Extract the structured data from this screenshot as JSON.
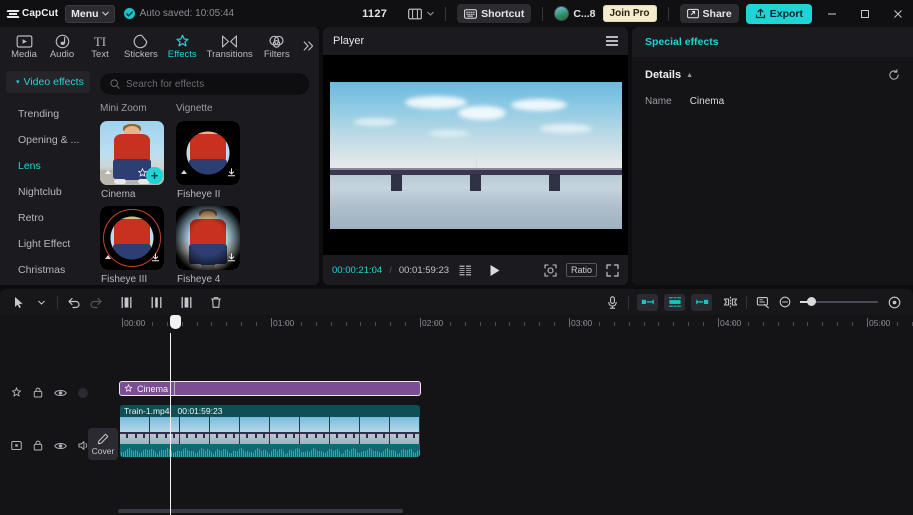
{
  "titlebar": {
    "app_name": "CapCut",
    "menu_label": "Menu",
    "autosave_text": "Auto saved: 10:05:44",
    "project_id": "1127",
    "shortcut_label": "Shortcut",
    "user_name": "C...8",
    "join_pro_label": "Join Pro",
    "share_label": "Share",
    "export_label": "Export",
    "minimize": "—",
    "maximize": "▫",
    "close": "✕",
    "accent": "#1fd4d4"
  },
  "left_panel": {
    "tabs": [
      {
        "label": "Media",
        "icon": "media-icon",
        "active": false
      },
      {
        "label": "Audio",
        "icon": "audio-icon",
        "active": false
      },
      {
        "label": "Text",
        "icon": "text-icon",
        "active": false
      },
      {
        "label": "Stickers",
        "icon": "stickers-icon",
        "active": false
      },
      {
        "label": "Effects",
        "icon": "effects-icon",
        "active": true
      },
      {
        "label": "Transitions",
        "icon": "transitions-icon",
        "active": false
      },
      {
        "label": "Filters",
        "icon": "filters-icon",
        "active": false
      }
    ],
    "more_tabs_icon": "chevron-double-right-icon",
    "category_header": "Video effects",
    "categories": [
      {
        "label": "Trending",
        "active": false
      },
      {
        "label": "Opening & ...",
        "active": false
      },
      {
        "label": "Lens",
        "active": true
      },
      {
        "label": "Nightclub",
        "active": false
      },
      {
        "label": "Retro",
        "active": false
      },
      {
        "label": "Light Effect",
        "active": false
      },
      {
        "label": "Christmas",
        "active": false
      }
    ],
    "search_placeholder": "Search for effects",
    "search_value": "",
    "grid_top_labels": [
      "Mini Zoom",
      "Vignette"
    ],
    "effects": [
      {
        "label": "Cinema",
        "style": "plain",
        "selected": true
      },
      {
        "label": "Fisheye II",
        "style": "circle"
      },
      {
        "label": "Fisheye III",
        "style": "circle-ring"
      },
      {
        "label": "Fisheye 4",
        "style": "vignette"
      }
    ]
  },
  "player": {
    "title": "Player",
    "menu_icon": "hamburger-icon",
    "current_time": "00:00:21:04",
    "separator": "/",
    "total_time": "00:01:59:23",
    "frames_icon": "frames-icon",
    "play_icon": "play-icon",
    "focus_icon": "focus-icon",
    "ratio_label": "Ratio",
    "fullscreen_icon": "fullscreen-icon"
  },
  "right_panel": {
    "title": "Special effects",
    "section_label": "Details",
    "reset_icon": "reset-icon",
    "rows": [
      {
        "key": "Name",
        "value": "Cinema"
      }
    ]
  },
  "timeline": {
    "tools_left": [
      {
        "name": "select-tool",
        "icon": "cursor-icon",
        "dim": false
      },
      {
        "name": "select-dropdown",
        "icon": "chevron-down-icon",
        "dim": false
      },
      {
        "name": "undo",
        "icon": "undo-icon",
        "dim": false
      },
      {
        "name": "redo",
        "icon": "redo-icon",
        "dim": true
      },
      {
        "name": "split",
        "icon": "split-icon",
        "dim": false
      },
      {
        "name": "trim-left",
        "icon": "trim-left-icon",
        "dim": false
      },
      {
        "name": "trim-right",
        "icon": "trim-right-icon",
        "dim": false
      },
      {
        "name": "delete",
        "icon": "trash-icon",
        "dim": false
      }
    ],
    "tools_right": [
      {
        "name": "record",
        "icon": "microphone-icon"
      },
      {
        "name": "keyframe-left",
        "icon": "keyframe-left-icon"
      },
      {
        "name": "keyframe-center",
        "icon": "keyframe-center-icon"
      },
      {
        "name": "keyframe-right",
        "icon": "keyframe-right-icon"
      },
      {
        "name": "mirror",
        "icon": "mirror-icon"
      },
      {
        "name": "crop",
        "icon": "crop-icon"
      },
      {
        "name": "zoom-out",
        "icon": "zoom-out-icon"
      },
      {
        "name": "zoom-in",
        "icon": "zoom-in-icon"
      }
    ],
    "ruler_labels": [
      "00:00",
      "01:00",
      "02:00",
      "03:00",
      "04:00",
      "05:00"
    ],
    "playhead_time": "00:00:21:04",
    "effect_track": {
      "icon": "effect-icon",
      "clip_label": "Cinema",
      "color": "#7a4d94"
    },
    "video_track": {
      "clip_name": "Train-1.mp4",
      "clip_duration": "00:01:59:23",
      "cover_label": "Cover",
      "cover_icon": "pencil-icon"
    },
    "track_controls_effect": [
      {
        "name": "effect-track-icon",
        "icon": "effect-icon"
      },
      {
        "name": "lock-effect-track",
        "icon": "lock-icon"
      },
      {
        "name": "hide-effect-track",
        "icon": "eye-icon"
      },
      {
        "name": "effect-track-placeholder",
        "icon": "dot-icon"
      }
    ],
    "track_controls_video": [
      {
        "name": "video-track-icon",
        "icon": "video-icon"
      },
      {
        "name": "lock-video-track",
        "icon": "lock-icon"
      },
      {
        "name": "hide-video-track",
        "icon": "eye-icon"
      },
      {
        "name": "mute-video-track",
        "icon": "speaker-icon"
      }
    ]
  }
}
